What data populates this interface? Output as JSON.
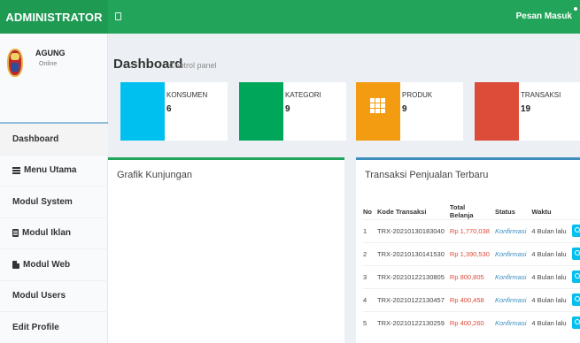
{
  "header": {
    "brand": "ADMINISTRATOR",
    "messages_label": "Pesan Masuk"
  },
  "user": {
    "name": "AGUNG",
    "status": "Online"
  },
  "menu": [
    {
      "label": "Dashboard",
      "icon": ""
    },
    {
      "label": "Menu Utama",
      "icon": "list-icon"
    },
    {
      "label": "Modul System",
      "icon": ""
    },
    {
      "label": "Modul Iklan",
      "icon": "file-icon"
    },
    {
      "label": "Modul Web",
      "icon": "web-icon"
    },
    {
      "label": "Modul Users",
      "icon": ""
    },
    {
      "label": "Edit Profile",
      "icon": ""
    }
  ],
  "page": {
    "title": "Dashboard",
    "subtitle": "Control panel"
  },
  "stats": [
    {
      "label": "KONSUMEN",
      "value": "6",
      "color": "#00c0ef"
    },
    {
      "label": "KATEGORI",
      "value": "9",
      "color": "#00a65a"
    },
    {
      "label": "PRODUK",
      "value": "9",
      "color": "#f39c12",
      "icon": "grid-icon"
    },
    {
      "label": "TRANSAKSI",
      "value": "19",
      "color": "#dd4b39"
    }
  ],
  "visits_panel": {
    "title": "Grafik Kunjungan"
  },
  "sales_panel": {
    "title": "Transaksi Penjualan Terbaru",
    "columns": [
      "No",
      "Kode Transaksi",
      "Total Belanja",
      "Status",
      "Waktu"
    ],
    "rows": [
      {
        "no": "1",
        "code": "TRX-20210130183040",
        "total": "Rp 1,770,038",
        "status": "Konfirmasi",
        "time": "4 Bulan lalu"
      },
      {
        "no": "2",
        "code": "TRX-20210130141530",
        "total": "Rp 1,390,530",
        "status": "Konfirmasi",
        "time": "4 Bulan lalu"
      },
      {
        "no": "3",
        "code": "TRX-20210122130805",
        "total": "Rp 800,805",
        "status": "Konfirmasi",
        "time": "4 Bulan lalu"
      },
      {
        "no": "4",
        "code": "TRX-20210122130457",
        "total": "Rp 400,458",
        "status": "Konfirmasi",
        "time": "4 Bulan lalu"
      },
      {
        "no": "5",
        "code": "TRX-20210122130259",
        "total": "Rp 400,260",
        "status": "Konfirmasi",
        "time": "4 Bulan lalu"
      }
    ]
  },
  "colors": {
    "header": "#22a55a",
    "logo": "#1e9a52"
  }
}
